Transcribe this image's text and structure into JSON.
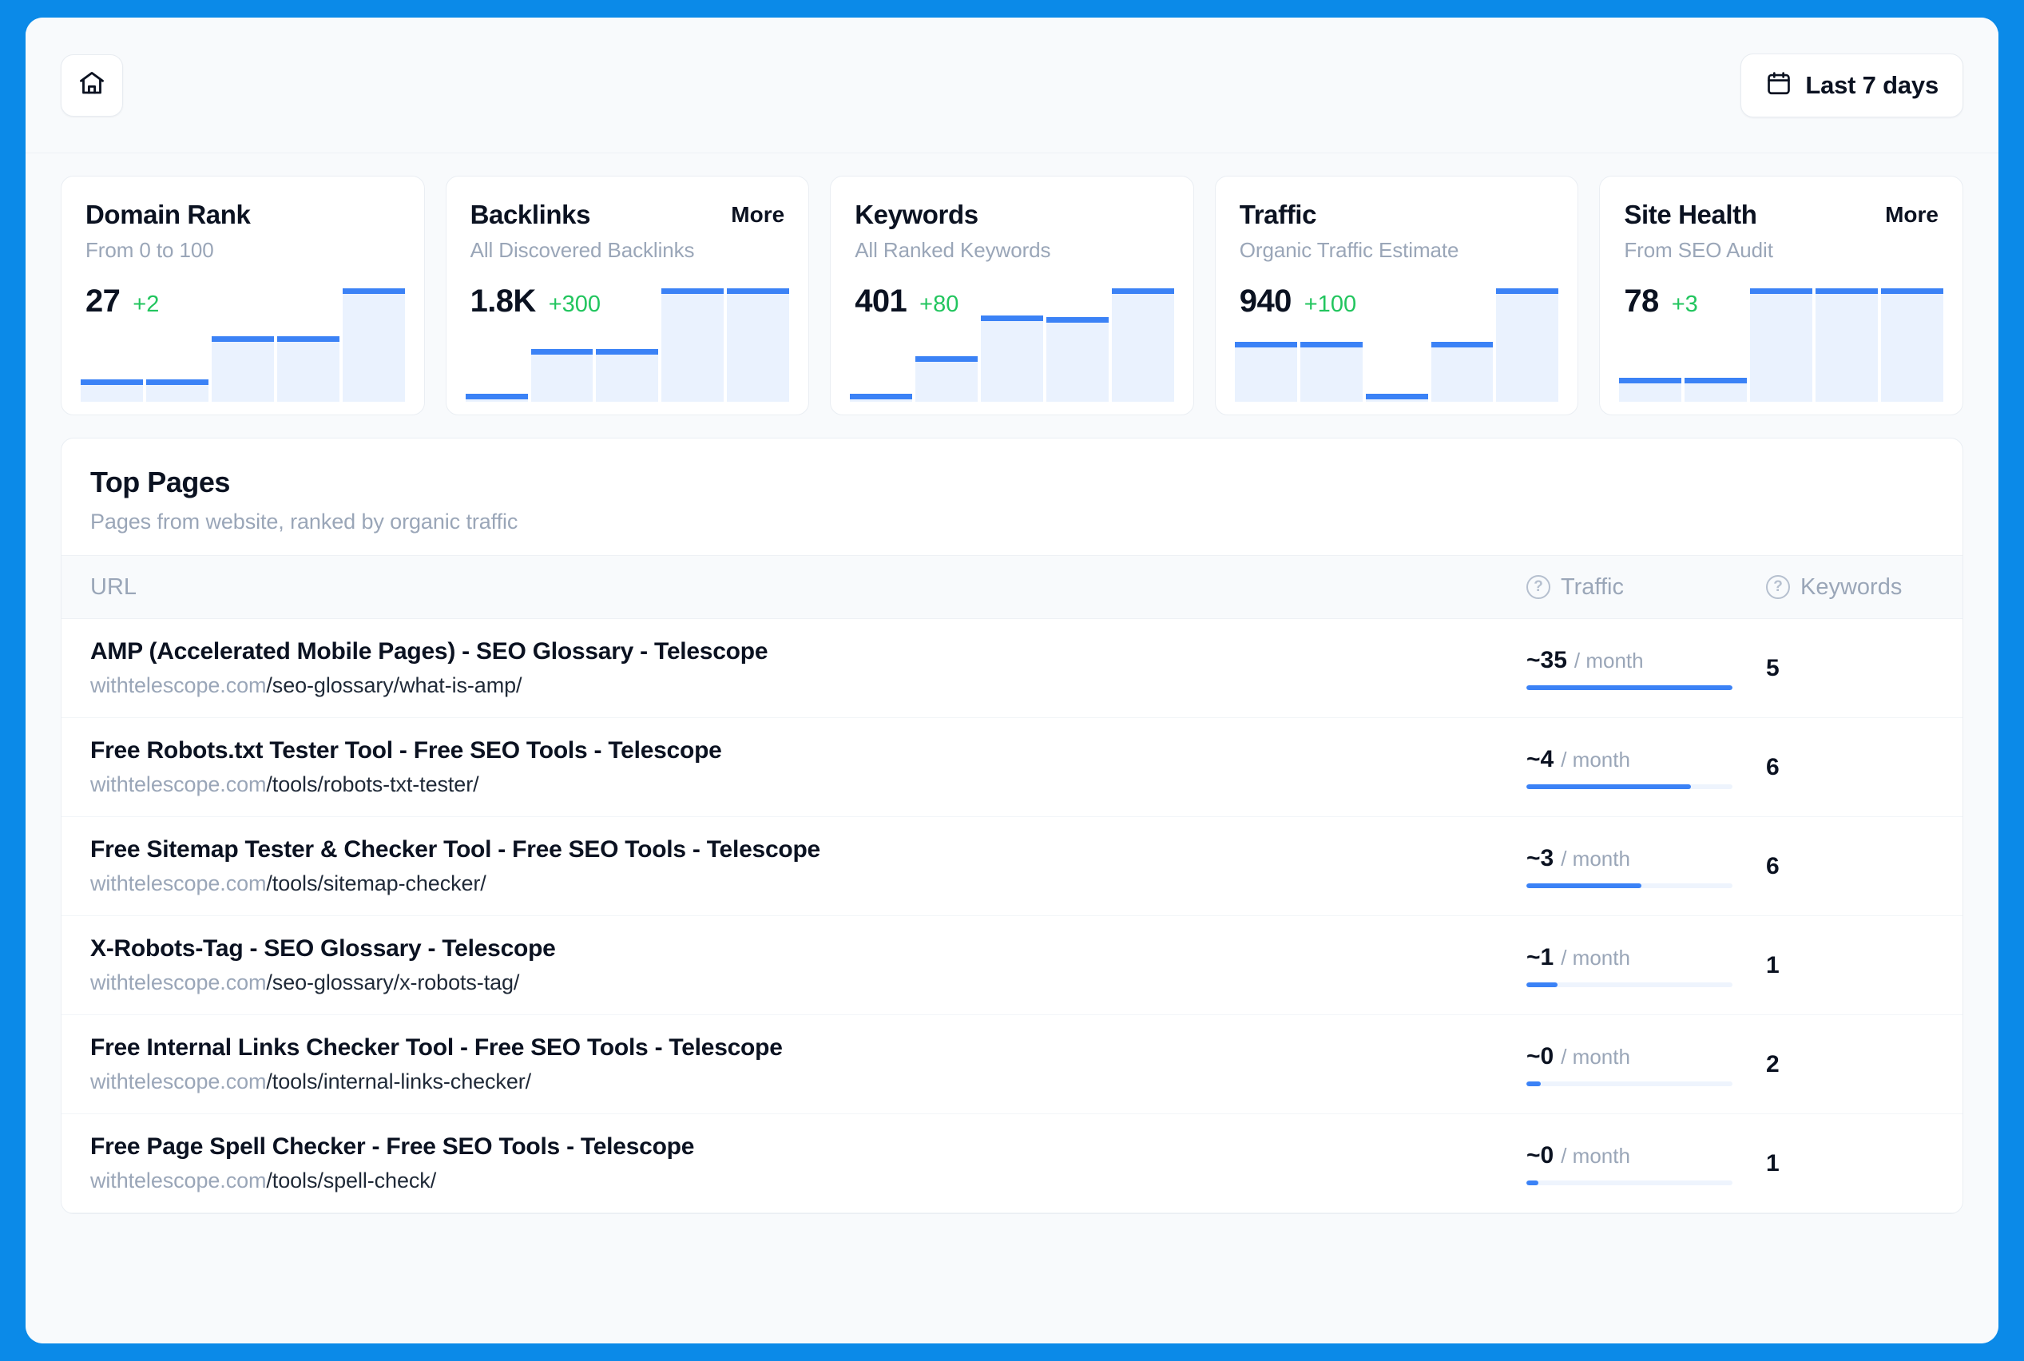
{
  "header": {
    "home_icon": "home-icon",
    "date_range": {
      "icon": "calendar-icon",
      "label": "Last 7 days"
    }
  },
  "accent_color": "#3b82f6",
  "positive_color": "#22c55e",
  "cards": [
    {
      "title": "Domain Rank",
      "subtitle": "From 0 to 100",
      "value": "27",
      "delta": "+2",
      "more_label": "",
      "spark": [
        18,
        18,
        52,
        52,
        90
      ]
    },
    {
      "title": "Backlinks",
      "subtitle": "All Discovered Backlinks",
      "value": "1.8K",
      "delta": "+300",
      "more_label": "More",
      "spark": [
        6,
        44,
        44,
        95,
        95
      ]
    },
    {
      "title": "Keywords",
      "subtitle": "All Ranked Keywords",
      "value": "401",
      "delta": "+80",
      "more_label": "",
      "spark": [
        6,
        38,
        72,
        71,
        95
      ]
    },
    {
      "title": "Traffic",
      "subtitle": "Organic Traffic Estimate",
      "value": "940",
      "delta": "+100",
      "more_label": "",
      "spark": [
        50,
        50,
        6,
        50,
        95
      ]
    },
    {
      "title": "Site Health",
      "subtitle": "From SEO Audit",
      "value": "78",
      "delta": "+3",
      "more_label": "More",
      "spark": [
        20,
        20,
        95,
        95,
        95
      ]
    }
  ],
  "top_pages": {
    "title": "Top Pages",
    "subtitle": "Pages from website, ranked by organic traffic",
    "columns": {
      "url": "URL",
      "traffic": "Traffic",
      "keywords": "Keywords",
      "traffic_help_icon": "help-circle-icon",
      "keywords_help_icon": "help-circle-icon"
    },
    "rows": [
      {
        "title": "AMP (Accelerated Mobile Pages) - SEO Glossary - Telescope",
        "domain": "withtelescope.com",
        "path": "/seo-glossary/what-is-amp/",
        "traffic_value": "~35",
        "traffic_unit": "/ month",
        "traffic_pct": 100,
        "keywords": "5"
      },
      {
        "title": "Free Robots.txt Tester Tool - Free SEO Tools - Telescope",
        "domain": "withtelescope.com",
        "path": "/tools/robots-txt-tester/",
        "traffic_value": "~4",
        "traffic_unit": "/ month",
        "traffic_pct": 80,
        "keywords": "6"
      },
      {
        "title": "Free Sitemap Tester & Checker Tool - Free SEO Tools - Telescope",
        "domain": "withtelescope.com",
        "path": "/tools/sitemap-checker/",
        "traffic_value": "~3",
        "traffic_unit": "/ month",
        "traffic_pct": 56,
        "keywords": "6"
      },
      {
        "title": "X-Robots-Tag - SEO Glossary - Telescope",
        "domain": "withtelescope.com",
        "path": "/seo-glossary/x-robots-tag/",
        "traffic_value": "~1",
        "traffic_unit": "/ month",
        "traffic_pct": 15,
        "keywords": "1"
      },
      {
        "title": "Free Internal Links Checker Tool - Free SEO Tools - Telescope",
        "domain": "withtelescope.com",
        "path": "/tools/internal-links-checker/",
        "traffic_value": "~0",
        "traffic_unit": "/ month",
        "traffic_pct": 7,
        "keywords": "2"
      },
      {
        "title": "Free Page Spell Checker - Free SEO Tools - Telescope",
        "domain": "withtelescope.com",
        "path": "/tools/spell-check/",
        "traffic_value": "~0",
        "traffic_unit": "/ month",
        "traffic_pct": 6,
        "keywords": "1"
      }
    ]
  }
}
